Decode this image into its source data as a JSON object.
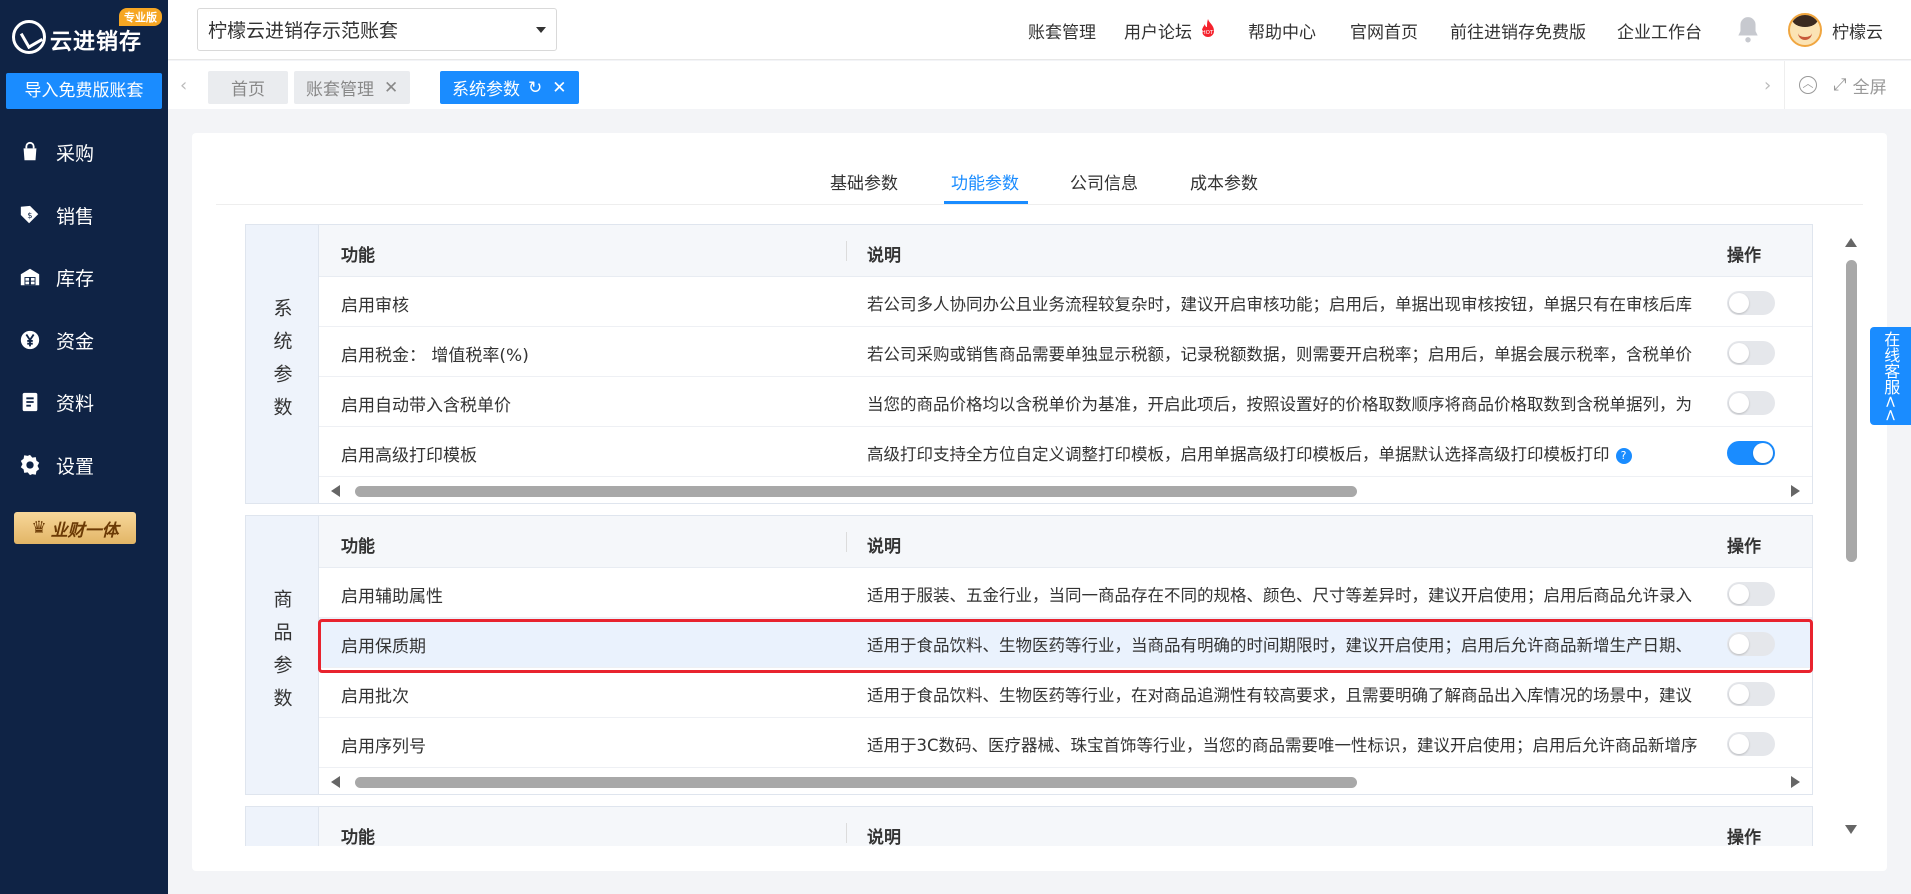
{
  "app": {
    "logo_text": "云进销存",
    "logo_badge": "专业版",
    "import_button": "导入免费版账套",
    "promo": "业财一体"
  },
  "sidebar": {
    "items": [
      {
        "label": "采购",
        "icon": "bag-icon"
      },
      {
        "label": "销售",
        "icon": "sales-tag-icon"
      },
      {
        "label": "库存",
        "icon": "warehouse-icon"
      },
      {
        "label": "资金",
        "icon": "yen-icon"
      },
      {
        "label": "资料",
        "icon": "document-icon"
      },
      {
        "label": "设置",
        "icon": "gear-icon"
      }
    ]
  },
  "header": {
    "account": "柠檬云进销存示范账套",
    "nav": [
      "账套管理",
      "用户论坛",
      "帮助中心",
      "官网首页",
      "前往进销存免费版",
      "企业工作台"
    ],
    "hot_badge": "HOT",
    "username": "柠檬云"
  },
  "tabs": {
    "items": [
      {
        "label": "首页"
      },
      {
        "label": "账套管理"
      },
      {
        "label": "系统参数"
      }
    ],
    "fullscreen": "全屏"
  },
  "subtabs": [
    "基础参数",
    "功能参数",
    "公司信息",
    "成本参数"
  ],
  "table_header": {
    "function": "功能",
    "description": "说明",
    "operation": "操作"
  },
  "sections": [
    {
      "label": "系统参数",
      "rows": [
        {
          "name": "启用审核",
          "desc": "若公司多人协同办公且业务流程较复杂时，建议开启审核功能；启用后，单据出现审核按钮，单据只有在审核后库",
          "on": false
        },
        {
          "name": "启用税金： 增值税率(%)",
          "desc": "若公司采购或销售商品需要单独显示税额，记录税额数据，则需要开启税率；启用后，单据会展示税率，含税单价",
          "on": false
        },
        {
          "name": "启用自动带入含税单价",
          "desc": "当您的商品价格均以含税单价为基准，开启此项后，按照设置好的价格取数顺序将商品价格取数到含税单据列，为",
          "on": false
        },
        {
          "name": "启用高级打印模板",
          "desc": "高级打印支持全方位自定义调整打印模板，启用单据高级打印模板后，单据默认选择高级打印模板打印",
          "on": true
        }
      ]
    },
    {
      "label": "商品参数",
      "rows": [
        {
          "name": "启用辅助属性",
          "desc": "适用于服装、五金行业，当同一商品存在不同的规格、颜色、尺寸等差异时，建议开启使用；启用后商品允许录入",
          "on": false
        },
        {
          "name": "启用保质期",
          "desc": "适用于食品饮料、生物医药等行业，当商品有明确的时间期限时，建议开启使用；启用后允许商品新增生产日期、",
          "on": false
        },
        {
          "name": "启用批次",
          "desc": "适用于食品饮料、生物医药等行业，在对商品追溯性有较高要求，且需要明确了解商品出入库情况的场景中，建议",
          "on": false
        },
        {
          "name": "启用序列号",
          "desc": "适用于3C数码、医疗器械、珠宝首饰等行业，当您的商品需要唯一性标识，建议开启使用；启用后允许商品新增序",
          "on": false
        }
      ]
    }
  ],
  "service_button": "在线客服<<",
  "colors": {
    "sidebar": "#0f2345",
    "accent": "#1a8cff",
    "highlight_border": "#e8232e"
  }
}
